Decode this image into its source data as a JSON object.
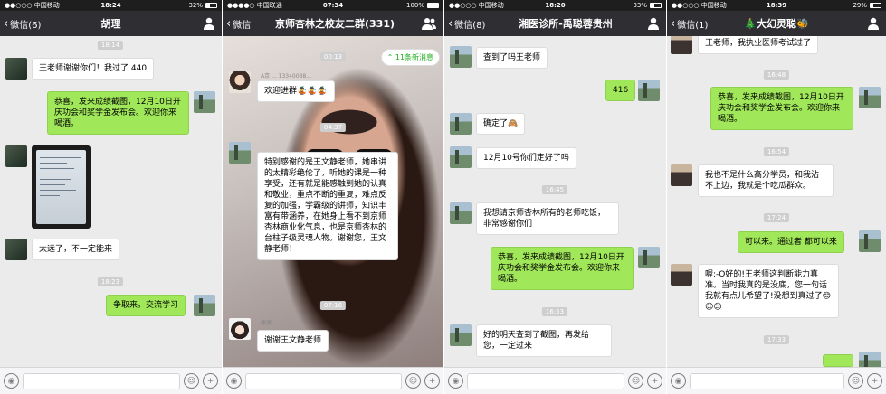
{
  "panel1": {
    "status": {
      "carrier": "●●○○○ 中国移动",
      "time": "18:24",
      "battery": "32%"
    },
    "nav": {
      "back": "微信(6)",
      "title": "胡理"
    },
    "stamps": [
      "18:14",
      "18:23"
    ],
    "messages": [
      {
        "text": "王老师谢谢你们！我过了 440"
      },
      {
        "text": "恭喜，发来成绩截图，12月10日开庆功会和奖学金发布会。欢迎你来喝酒。"
      },
      {
        "text": "太远了，不一定能来"
      },
      {
        "text": "争取来。交流学习"
      }
    ]
  },
  "panel2": {
    "status": {
      "carrier": "●●●●○ 中国联通",
      "time": "07:34",
      "battery": "100%"
    },
    "nav": {
      "back": "微信",
      "title": "京师杏林之校友二群(331)"
    },
    "new_messages": "11条新消息",
    "stamps": [
      "00:13",
      "04:37",
      "07:16"
    ],
    "senders": [
      "A京 ... 13340088...",
      "康康"
    ],
    "messages": [
      {
        "text": "欢迎进群🤹🤹🤹"
      },
      {
        "text": "特别感谢的是王文静老师，她串讲的太精彩绝伦了，听她的课是一种享受，还有就是能感触到她的认真和敬业，重点不断的重复，难点反复的加强，学霸级的讲师，知识丰富有带涵养，在她身上看不到京师杏林商业化气息，也是京师杏林的台柱子级灵魂人物。谢谢您，王文静老师！"
      },
      {
        "text": "谢谢王文静老师"
      }
    ]
  },
  "panel3": {
    "status": {
      "carrier": "●●○○○ 中国移动",
      "time": "18:20",
      "battery": "33%"
    },
    "nav": {
      "back": "微信(8)",
      "title": "湘医诊所-禹聪蓉贵州"
    },
    "stamps": [
      "16:45",
      "16:53"
    ],
    "messages": [
      {
        "text": "查到了吗王老师"
      },
      {
        "text": "416"
      },
      {
        "text": "确定了🙈"
      },
      {
        "text": "12月10号你们定好了吗"
      },
      {
        "text": "我想请京师杏林所有的老师吃饭，非常感谢你们"
      },
      {
        "text": "恭喜，发来成绩截图，12月10日开庆功会和奖学金发布会。欢迎你来喝酒。"
      },
      {
        "text": "好的明天查到了截图，再发给您，一定过来"
      }
    ]
  },
  "panel4": {
    "status": {
      "carrier": "●●○○○ 中国移动",
      "time": "18:39",
      "battery": "29%"
    },
    "nav": {
      "back": "微信(1)",
      "title": "🎄大幻灵聪🐝"
    },
    "stamps": [
      "16:48",
      "16:54",
      "17:24",
      "17:33"
    ],
    "messages": [
      {
        "text": "王老师，我执业医师考试过了"
      },
      {
        "text": "恭喜，发来成绩截图，12月10日开庆功会和奖学金发布会。欢迎你来喝酒。"
      },
      {
        "text": "我也不是什么高分学员，和我沾不上边，我就是个吃瓜群众。"
      },
      {
        "text": "可以来。通过者 都可以来"
      },
      {
        "text": "喔:-O好的!王老师这判断能力真准。当时我真的是没底，您一句话我就有点儿希望了!没想到真过了😊😊😊"
      }
    ]
  },
  "icons": {
    "back": "chevron-left-icon",
    "profile": "person-icon",
    "group": "group-icon",
    "voice": "voice-icon",
    "emoji": "emoji-icon",
    "add": "plus-icon"
  },
  "colors": {
    "navbar": "#2e2e33",
    "my_bubble": "#a0e75a",
    "their_bubble": "#ffffff",
    "chat_bg": "#ebebeb"
  }
}
